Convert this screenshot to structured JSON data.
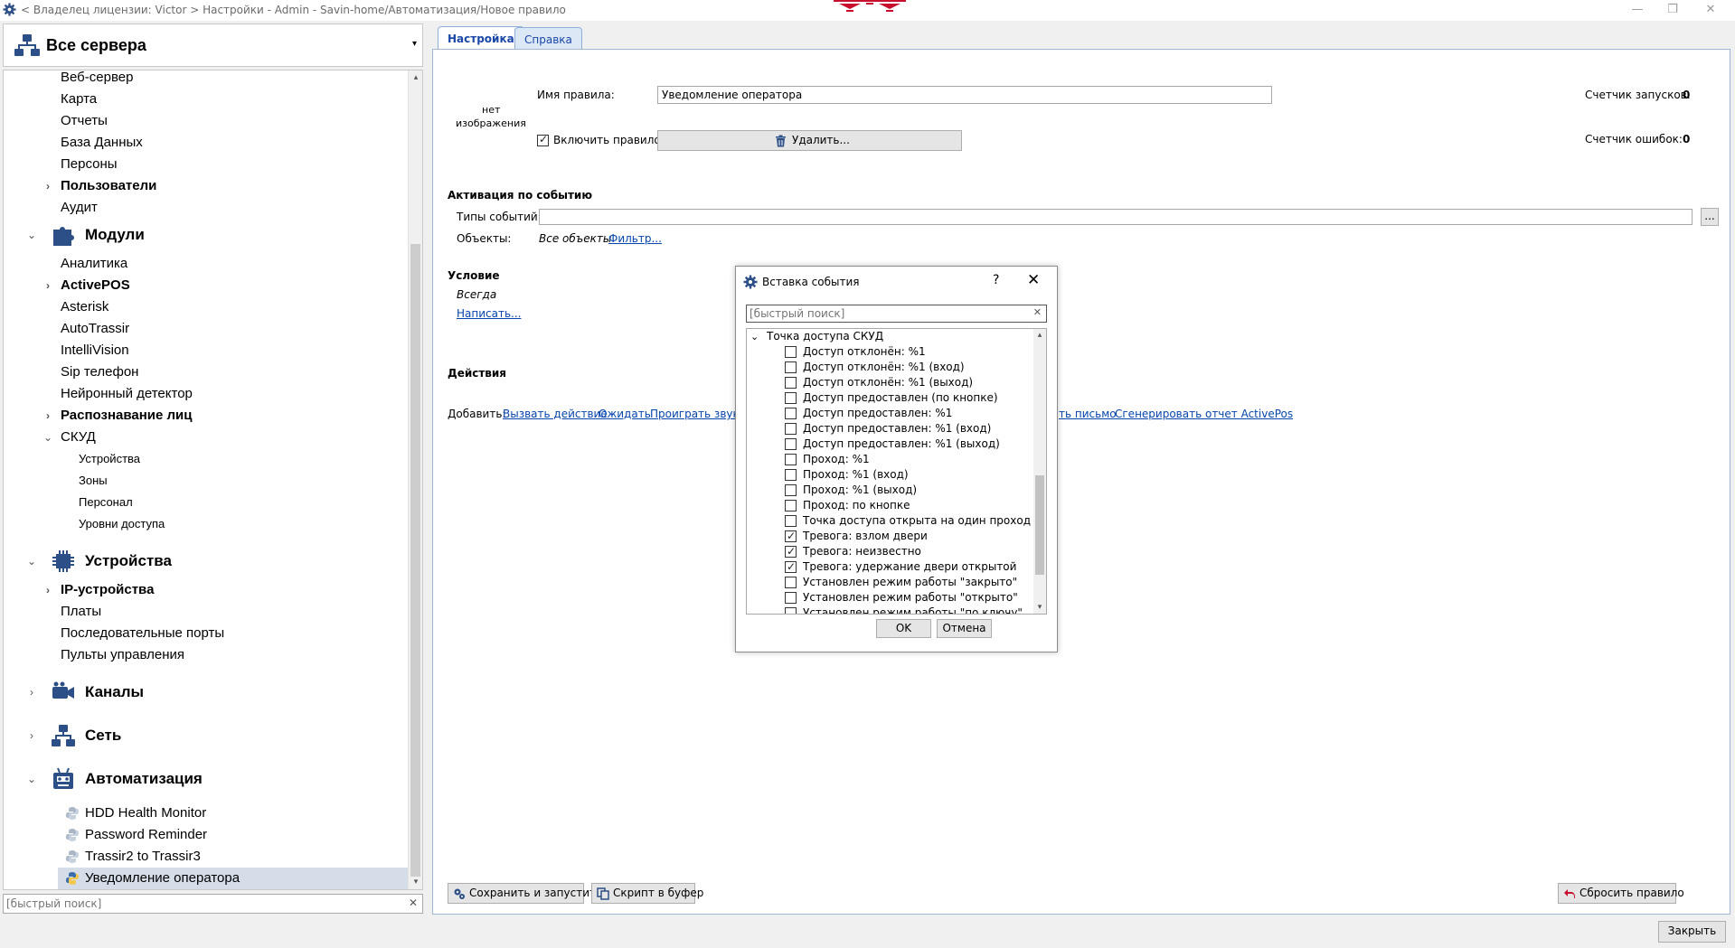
{
  "window": {
    "breadcrumb": "< Владелец лицензии: Victor > Настройки - Admin - Savin-home/Автоматизация/Новое правило",
    "minimize_glyph": "—",
    "restore_glyph": "❐",
    "close_glyph": "✕"
  },
  "server_select": {
    "label": "Все сервера",
    "arrow": "▾"
  },
  "tree": {
    "scroll_up": "▴",
    "scroll_down": "▾",
    "items": [
      {
        "label": "Веб-сервер"
      },
      {
        "label": "Карта"
      },
      {
        "label": "Отчеты"
      },
      {
        "label": "База Данных"
      },
      {
        "label": "Персоны"
      },
      {
        "label": "Пользователи",
        "expander": "›"
      },
      {
        "label": "Аудит"
      },
      {
        "label": "Модули",
        "expander": "⌄",
        "icon": "puzzle-icon"
      },
      {
        "label": "Аналитика"
      },
      {
        "label": "ActivePOS",
        "expander": "›"
      },
      {
        "label": "Asterisk"
      },
      {
        "label": "AutoTrassir"
      },
      {
        "label": "IntelliVision"
      },
      {
        "label": "Sip телефон"
      },
      {
        "label": "Нейронный детектор"
      },
      {
        "label": "Распознавание лиц",
        "expander": "›"
      },
      {
        "label": "СКУД",
        "expander": "⌄"
      },
      {
        "label": "Устройства"
      },
      {
        "label": "Зоны"
      },
      {
        "label": "Персонал"
      },
      {
        "label": "Уровни доступа"
      },
      {
        "label": "Устройства",
        "expander": "⌄",
        "icon": "chip-icon"
      },
      {
        "label": "IP-устройства",
        "expander": "›"
      },
      {
        "label": "Платы"
      },
      {
        "label": "Последовательные порты"
      },
      {
        "label": "Пульты управления"
      },
      {
        "label": "Каналы",
        "expander": "›",
        "icon": "camera-icon"
      },
      {
        "label": "Сеть",
        "expander": "›",
        "icon": "network-icon"
      },
      {
        "label": "Автоматизация",
        "expander": "⌄",
        "icon": "robot-icon"
      },
      {
        "label": "HDD Health Monitor",
        "icon": "python-icon"
      },
      {
        "label": "Password Reminder",
        "icon": "python-icon"
      },
      {
        "label": "Trassir2 to Trassir3",
        "icon": "python-icon"
      },
      {
        "label": "Уведомление оператора",
        "icon": "python-icon",
        "selected": true
      }
    ]
  },
  "left_search": {
    "placeholder": "[быстрый поиск]",
    "clear": "✕"
  },
  "tabs": {
    "settings": "Настройка",
    "help": "Справка"
  },
  "rule": {
    "no_image_line1": "нет",
    "no_image_line2": "изображения",
    "name_label": "Имя правила:",
    "name_value": "Уведомление оператора",
    "enable_label": "Включить правило",
    "enabled": true,
    "delete_label": "Удалить...",
    "run_counter_label": "Счетчик запусков:",
    "run_counter_value": "0",
    "error_counter_label": "Счетчик ошибок:",
    "error_counter_value": "0"
  },
  "activation": {
    "heading": "Активация по событию",
    "event_types_label": "Типы событий:",
    "event_types_value": "",
    "browse_label": "...",
    "objects_label": "Объекты:",
    "objects_value": "Все объекты",
    "filter_link": "Фильтр..."
  },
  "condition": {
    "heading": "Условие",
    "value": "Всегда",
    "write_link": "Написать..."
  },
  "actions": {
    "heading": "Действия",
    "add_label": "Добавить:",
    "links": [
      "Вызвать действие",
      "Ожидать",
      "Проиграть звук",
      "ть письмо",
      "Сгенерировать отчет ActivePos"
    ]
  },
  "bottom": {
    "save_run": "Сохранить и запустить",
    "script_buffer": "Скрипт в буфер",
    "reset_rule": "Сбросить правило",
    "close": "Закрыть"
  },
  "dialog": {
    "title": "Вставка события",
    "help": "?",
    "close": "✕",
    "search_placeholder": "[быстрый поиск]",
    "search_clear": "✕",
    "group": "Точка доступа СКУД",
    "group_expander": "⌄",
    "items": [
      {
        "label": "Доступ отклонён: %1",
        "checked": false
      },
      {
        "label": "Доступ отклонён: %1 (вход)",
        "checked": false
      },
      {
        "label": "Доступ отклонён: %1 (выход)",
        "checked": false
      },
      {
        "label": "Доступ предоставлен (по кнопке)",
        "checked": false
      },
      {
        "label": "Доступ предоставлен: %1",
        "checked": false
      },
      {
        "label": "Доступ предоставлен: %1 (вход)",
        "checked": false
      },
      {
        "label": "Доступ предоставлен: %1 (выход)",
        "checked": false
      },
      {
        "label": "Проход: %1",
        "checked": false
      },
      {
        "label": "Проход: %1 (вход)",
        "checked": false
      },
      {
        "label": "Проход: %1 (выход)",
        "checked": false
      },
      {
        "label": "Проход: по кнопке",
        "checked": false
      },
      {
        "label": "Точка доступа открыта на один проход",
        "checked": false
      },
      {
        "label": "Тревога: взлом двери",
        "checked": true
      },
      {
        "label": "Тревога: неизвестно",
        "checked": true
      },
      {
        "label": "Тревога: удержание двери открытой",
        "checked": true
      },
      {
        "label": "Установлен режим работы \"закрыто\"",
        "checked": false
      },
      {
        "label": "Установлен режим работы \"открыто\"",
        "checked": false
      },
      {
        "label": "Установлен режим работы \"по ключу\"",
        "checked": false
      }
    ],
    "ok": "OK",
    "cancel": "Отмена"
  },
  "colors": {
    "accent": "#1a47a8",
    "link": "#0645ad",
    "selection": "#d5dde8",
    "logo": "#c8102e"
  }
}
